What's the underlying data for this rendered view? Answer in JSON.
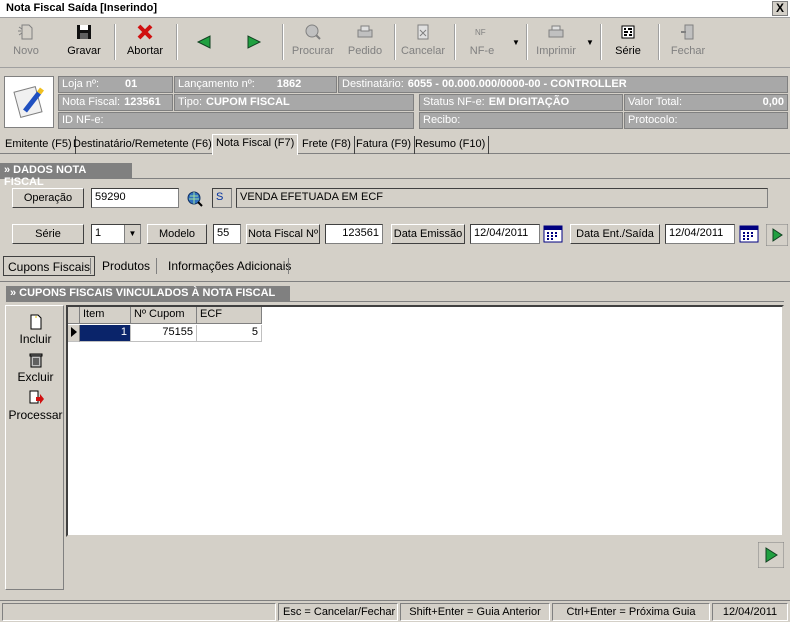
{
  "window": {
    "title": "Nota Fiscal Saída [Inserindo]",
    "close": "X"
  },
  "toolbar": [
    {
      "label": "Novo",
      "icon": "new-doc-icon",
      "enabled": false
    },
    {
      "label": "Gravar",
      "icon": "save-disk-icon",
      "enabled": true
    },
    {
      "label": "Abortar",
      "icon": "abort-x-icon",
      "enabled": true
    },
    {
      "label": "",
      "icon": "previous-arrow-icon",
      "enabled": true
    },
    {
      "label": "",
      "icon": "next-arrow-icon",
      "enabled": true
    },
    {
      "label": "Procurar",
      "icon": "search-icon",
      "enabled": false
    },
    {
      "label": "Pedido",
      "icon": "order-icon",
      "enabled": false
    },
    {
      "label": "Cancelar",
      "icon": "cancel-icon",
      "enabled": false
    },
    {
      "label": "NF-e",
      "icon": "nfe-icon",
      "enabled": false
    },
    {
      "label": "Imprimir",
      "icon": "printer-icon",
      "enabled": false
    },
    {
      "label": "Série",
      "icon": "series-icon",
      "enabled": true
    },
    {
      "label": "Fechar",
      "icon": "close-door-icon",
      "enabled": false
    }
  ],
  "header": {
    "loja_label": "Loja nº:",
    "loja_value": "01",
    "lanc_label": "Lançamento nº:",
    "lanc_value": "1862",
    "dest_label": "Destinatário:",
    "dest_value": "6055 - 00.000.000/0000-00 - CONTROLLER",
    "nf_label": "Nota Fiscal:",
    "nf_value": "123561",
    "tipo_label": "Tipo:",
    "tipo_value": "CUPOM FISCAL",
    "status_label": "Status NF-e:",
    "status_value": "EM DIGITAÇÃO",
    "valor_label": "Valor Total:",
    "valor_value": "0,00",
    "id_label": "ID NF-e:",
    "recibo_label": "Recibo:",
    "protocolo_label": "Protocolo:"
  },
  "tabs": [
    "Emitente (F5)",
    "Destinatário/Remetente (F6)",
    "Nota Fiscal (F7)",
    "Frete (F8)",
    "Fatura (F9)",
    "Resumo (F10)"
  ],
  "dados": {
    "section": "» DADOS NOTA FISCAL",
    "operacao_label": "Operação",
    "operacao_value": "59290",
    "operacao_flag": "S",
    "operacao_desc": "VENDA EFETUADA EM ECF",
    "serie_label": "Série",
    "serie_value": "1",
    "modelo_label": "Modelo",
    "modelo_value": "55",
    "nfn_label": "Nota Fiscal Nº",
    "nfn_value": "123561",
    "emissao_label": "Data Emissão",
    "emissao_value": "12/04/2011",
    "entsaida_label": "Data Ent./Saída",
    "entsaida_value": "12/04/2011"
  },
  "subtabs": [
    "Cupons Fiscais",
    "Produtos",
    "Informações Adicionais"
  ],
  "cupons": {
    "section": "» CUPONS FISCAIS VINCULADOS  À NOTA FISCAL",
    "incluir": "Incluir",
    "excluir": "Excluir",
    "processar": "Processar",
    "columns": [
      "Item",
      "Nº Cupom",
      "ECF"
    ],
    "rows": [
      {
        "item": "1",
        "cupom": "75155",
        "ecf": "5"
      }
    ]
  },
  "statusbar": {
    "esc": "Esc = Cancelar/Fechar",
    "shift": "Shift+Enter = Guia Anterior",
    "ctrl": "Ctrl+Enter = Próxima Guia",
    "date": "12/04/2011"
  }
}
